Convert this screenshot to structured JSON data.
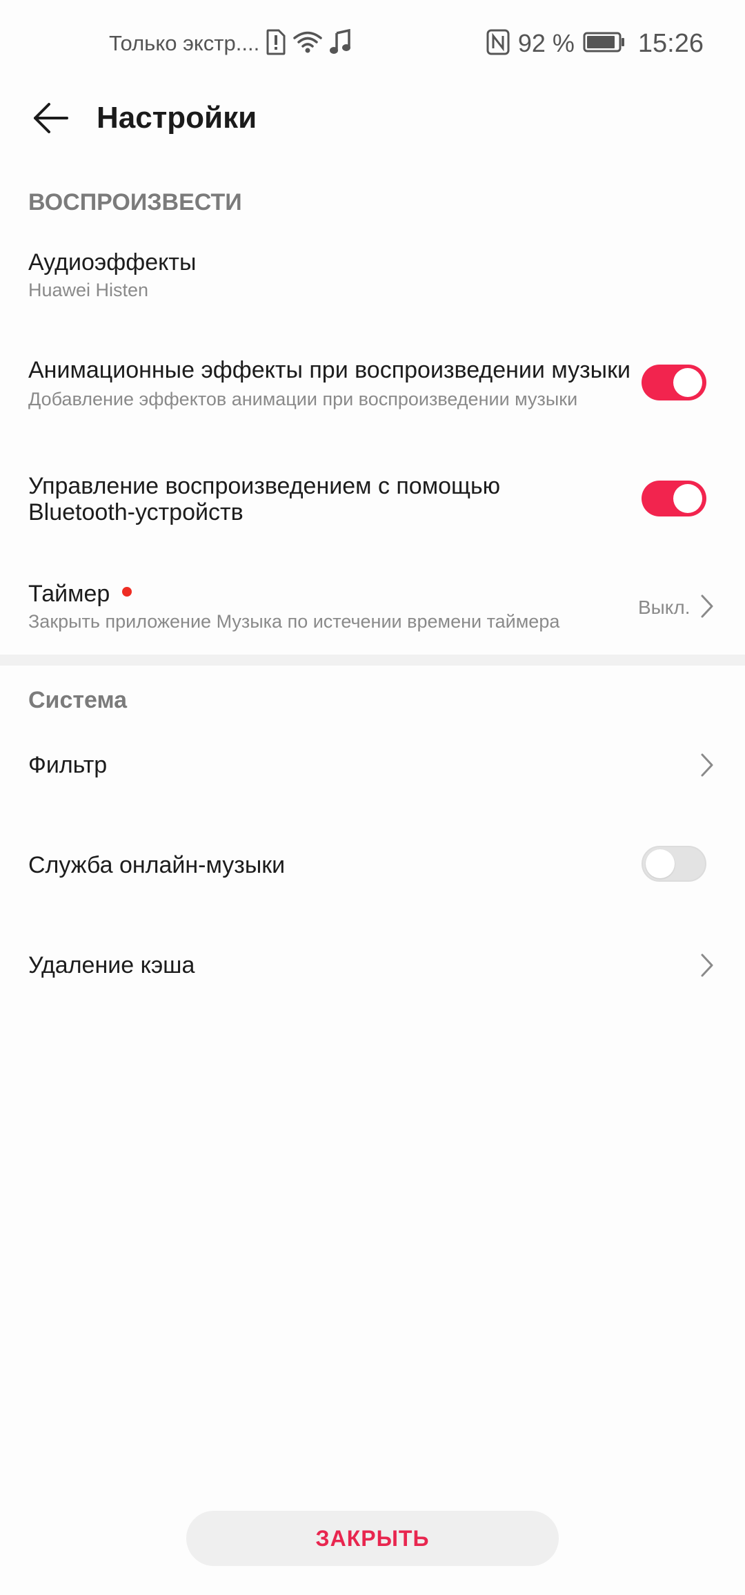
{
  "status_bar": {
    "carrier": "Только экстр....",
    "battery_percent": "92 %",
    "battery_level": 0.92,
    "time": "15:26",
    "icons": [
      "sim-alert-icon",
      "wifi-icon",
      "music-note-icon",
      "nfc-icon",
      "battery-icon"
    ]
  },
  "header": {
    "title": "Настройки",
    "back_icon": "arrow-left-icon"
  },
  "sections": {
    "playback": {
      "title": "ВОСПРОИЗВЕСТИ",
      "audio_effects": {
        "title": "Аудиоэффекты",
        "subtitle": "Huawei Histen"
      },
      "animation_effects": {
        "title": "Анимационные эффекты при воспроизведении музыки",
        "subtitle": "Добавление эффектов анимации при воспроизведении музыки",
        "enabled": true
      },
      "bluetooth_control": {
        "title_line1": "Управление воспроизведением с помощью",
        "title_line2": "Bluetooth-устройств",
        "enabled": true
      },
      "timer": {
        "title": "Таймер",
        "subtitle": "Закрыть приложение Музыка по истечении времени таймера",
        "value": "Выкл.",
        "has_badge": true
      }
    },
    "system": {
      "title": "Система",
      "filter": {
        "title": "Фильтр"
      },
      "online_music": {
        "title": "Служба онлайн-музыки",
        "enabled": false
      },
      "clear_cache": {
        "title": "Удаление кэша"
      }
    }
  },
  "footer": {
    "close_label": "ЗАКРЫТЬ"
  },
  "colors": {
    "accent": "#f2244e",
    "close_text": "#e8264f",
    "badge": "#ee2d24",
    "secondary_text": "#8a8a8a"
  }
}
